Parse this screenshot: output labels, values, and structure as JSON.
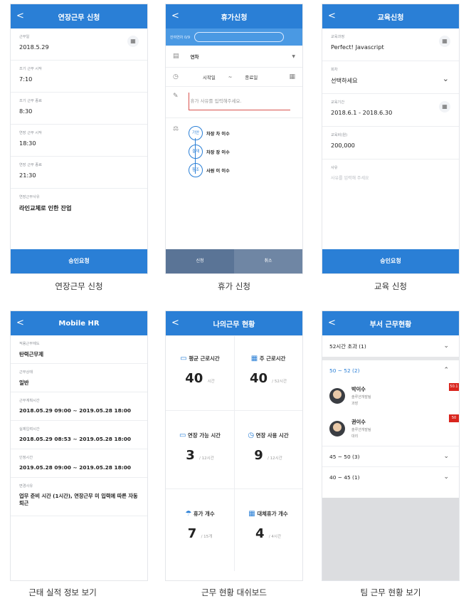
{
  "overtime": {
    "back": "<",
    "title": "연장근무 신청",
    "fields": [
      {
        "label": "근무일",
        "value": "2018.5.29"
      },
      {
        "label": "조기 근무 시작",
        "value": "7:10"
      },
      {
        "label": "조기 근무 종료",
        "value": "8:30"
      },
      {
        "label": "연장 근무 시작",
        "value": "18:30"
      },
      {
        "label": "연장 근무 종료",
        "value": "21:30"
      },
      {
        "label": "연장근무사유",
        "value": "라인교체로 인한 잔업"
      }
    ],
    "submit": "승인요청",
    "caption": "연장근무 신청"
  },
  "vacation": {
    "back": "<",
    "title": "휴가신청",
    "top_label": "잔여연차 0/9",
    "type": "연차",
    "start_label": "시작일",
    "tilde": "~",
    "end_label": "종료일",
    "reason_placeholder": "휴가 사유를 입력해주세요.",
    "approvers": [
      {
        "role": "기안",
        "name": "차장 차 이수"
      },
      {
        "role": "결재",
        "name": "차장 장 이수"
      },
      {
        "role": "참조",
        "name": "사원 이 이수"
      }
    ],
    "apply": "신청",
    "cancel": "취소",
    "caption": "휴가 신청"
  },
  "education": {
    "back": "<",
    "title": "교육신청",
    "fields": [
      {
        "label": "교육과정",
        "value": "Perfect! Javascript"
      },
      {
        "label": "회차",
        "value": "선택하세요"
      },
      {
        "label": "교육기간",
        "value": "2018.6.1 - 2018.6.30"
      },
      {
        "label": "교육비(원)",
        "value": "200,000"
      },
      {
        "label": "사유",
        "value": "사유를 입력해 주세요"
      }
    ],
    "submit": "승인요청",
    "caption": "교육 신청"
  },
  "mobilehr": {
    "back": "<",
    "title": "Mobile HR",
    "fields": [
      {
        "label": "적용근무제도",
        "value": "탄력근무제"
      },
      {
        "label": "근무상태",
        "value": "일반"
      },
      {
        "label": "근무계획시간",
        "value": "2018.05.29 09:00 ~ 2019.05.28 18:00"
      },
      {
        "label": "실제입력시간",
        "value": "2018.05.29 08:53 ~ 2019.05.28 18:00"
      },
      {
        "label": "인정시간",
        "value": "2019.05.28 09:00 ~ 2019.05.28 18:00"
      },
      {
        "label": "변경사유",
        "value": "업무 준비 시간 (1시간), 연장근무 미 입력에 따른 자동 퇴근"
      }
    ],
    "caption": "근태 실적 정보 보기"
  },
  "dashboard": {
    "back": "<",
    "title": "나의근무 현황",
    "cells": [
      {
        "title": "평균 근로시간",
        "value": "40",
        "unit": "시간"
      },
      {
        "title": "주 근로시간",
        "value": "40",
        "unit": "/ 52시간"
      },
      {
        "title": "연장 가능 시간",
        "value": "3",
        "unit": "/ 12시간"
      },
      {
        "title": "연장 사용 시간",
        "value": "9",
        "unit": "/ 12시간"
      },
      {
        "title": "휴가 개수",
        "value": "7",
        "unit": "/ 15개"
      },
      {
        "title": "대체휴가 개수",
        "value": "4",
        "unit": "/ 4시간"
      }
    ],
    "caption": "근무 현황 대쉬보드"
  },
  "team": {
    "back": "<",
    "title": "부서 근무현황",
    "groups": [
      {
        "label": "52시간 초과 (1)"
      },
      {
        "label": "50 ~ 52 (2)"
      },
      {
        "label": "45 ~ 50 (3)"
      },
      {
        "label": "40 ~ 45 (1)"
      }
    ],
    "people": [
      {
        "name": "박이수",
        "team": "솔루션개발팀",
        "rank": "과장",
        "badge": "50.1"
      },
      {
        "name": "권이수",
        "team": "솔루션개발팀",
        "rank": "대리",
        "badge": "50"
      }
    ],
    "caption": "팀 근무 현황 보기"
  },
  "colors": {
    "primary": "#2a7fd6",
    "badge": "#d9251d"
  }
}
